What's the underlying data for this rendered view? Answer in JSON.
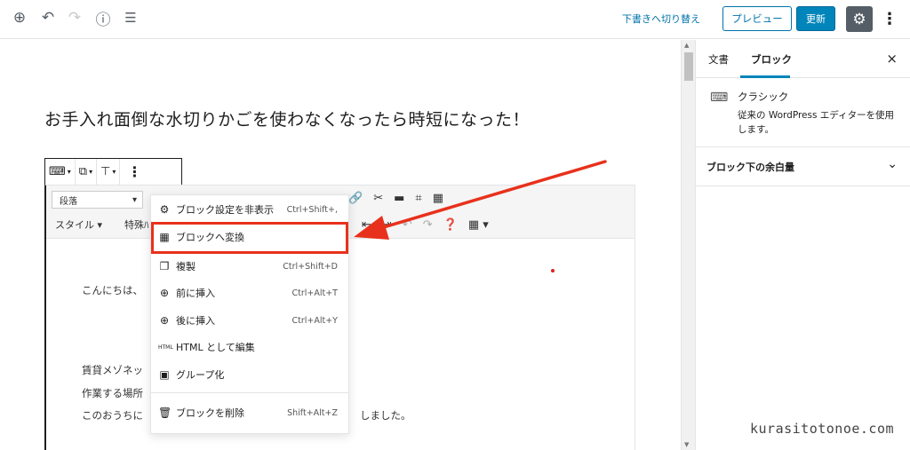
{
  "topbar": {
    "icons": [
      "add-block-icon",
      "undo-icon",
      "redo-icon",
      "info-icon",
      "outline-icon"
    ],
    "switch_draft_label": "下書きへ切り替え",
    "preview_label": "プレビュー",
    "update_label": "更新"
  },
  "editor": {
    "post_title": "お手入れ面倒な水切りかごを使わなくなったら時短になった！",
    "classic": {
      "format_value": "段落",
      "style_menu_label": "スタイル ▾",
      "special_menu_label": "特殊ﾊ",
      "paragraphs": [
        "こんにちは、",
        "賃貸メゾネッ",
        "作業する場所",
        "このおうちに",
        "しました。"
      ]
    }
  },
  "dropdown": {
    "items": [
      {
        "icon": "gear-icon",
        "label": "ブロック設定を非表示",
        "shortcut": "Ctrl+Shift+,"
      },
      {
        "icon": "blocks-icon",
        "label": "ブロックへ変換",
        "shortcut": ""
      },
      {
        "icon": "duplicate-icon",
        "label": "複製",
        "shortcut": "Ctrl+Shift+D"
      },
      {
        "icon": "insert-before-icon",
        "label": "前に挿入",
        "shortcut": "Ctrl+Alt+T"
      },
      {
        "icon": "insert-after-icon",
        "label": "後に挿入",
        "shortcut": "Ctrl+Alt+Y"
      },
      {
        "icon": "html-icon",
        "label": "HTML として編集",
        "shortcut": ""
      },
      {
        "icon": "group-icon",
        "label": "グループ化",
        "shortcut": ""
      },
      {
        "icon": "trash-icon",
        "label": "ブロックを削除",
        "shortcut": "Shift+Alt+Z"
      }
    ],
    "html_icon_text": "HTML"
  },
  "sidebar": {
    "tab_document": "文書",
    "tab_block": "ブロック",
    "close_label": "×",
    "block_title": "クラシック",
    "block_desc": "従来の WordPress エディターを使用します。",
    "panel_title": "ブロック下の余白量"
  },
  "watermark": "kurasitotonoe.com",
  "colors": {
    "accent": "#0085ba",
    "link": "#0073aa",
    "highlight": "#e8311c",
    "gear_bg": "#555d66"
  }
}
